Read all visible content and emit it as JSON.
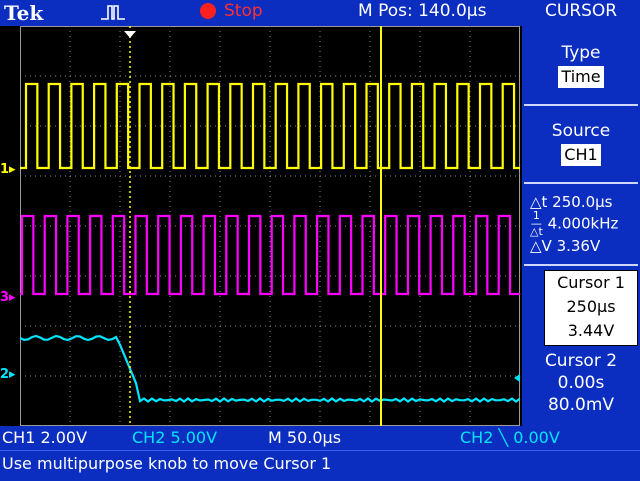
{
  "header": {
    "brand": "Tek",
    "trigger_icon": "trigger-pulse-icon",
    "run_state": "Stop",
    "horizontal_position": "M Pos: 140.0µs",
    "menu_title": "CURSOR"
  },
  "menu": {
    "type": {
      "label": "Type",
      "value": "Time"
    },
    "source": {
      "label": "Source",
      "value": "CH1"
    },
    "readouts": {
      "delta_t": "△t 250.0µs",
      "inv_delta_t": "4.000kHz",
      "delta_v": "△V 3.36V"
    },
    "cursor1": {
      "title": "Cursor 1",
      "time": "250µs",
      "volts": "3.44V"
    },
    "cursor2": {
      "title": "Cursor 2",
      "time": "0.00s",
      "volts": "80.0mV"
    }
  },
  "bottom": {
    "ch1_scale": "CH1  2.00V",
    "ch2_scale": "CH2  5.00V",
    "timebase": "M 50.0µs",
    "trigger": "CH2 ╲ 0.00V"
  },
  "status_message": "Use multipurpose knob to move Cursor 1",
  "channels": [
    {
      "marker": "1",
      "color": "#ffff00"
    },
    {
      "marker": "3",
      "color": "#ff00ff"
    },
    {
      "marker": "2",
      "color": "#00e5ff"
    }
  ]
}
